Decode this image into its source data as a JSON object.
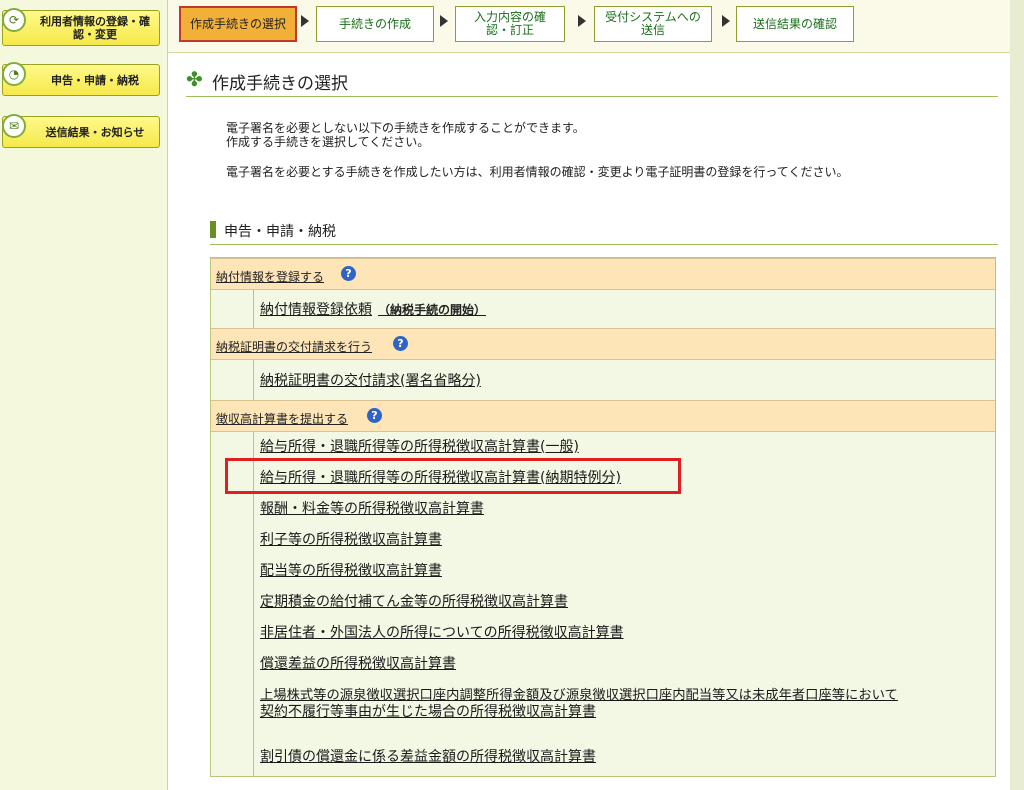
{
  "sidebar": {
    "items": [
      {
        "label": "利用者情報の登録・確認・変更",
        "icon": "refresh-icon"
      },
      {
        "label": "申告・申請・納税",
        "icon": "document-icon"
      },
      {
        "label": "送信結果・お知らせ",
        "icon": "mail-icon"
      }
    ]
  },
  "steps": [
    {
      "label": "作成手続きの選択",
      "active": true
    },
    {
      "label": "手続きの作成"
    },
    {
      "label": "入力内容の確認・訂正"
    },
    {
      "label": "受付システムへの送信"
    },
    {
      "label": "送信結果の確認"
    }
  ],
  "main": {
    "title": "作成手続きの選択",
    "para1_line1": "電子署名を必要としない以下の手続きを作成することができます。",
    "para1_line2": "作成する手続きを選択してください。",
    "para2": "電子署名を必要とする手続きを作成したい方は、利用者情報の確認・変更より電子証明書の登録を行ってください。",
    "section_title": "申告・申請・納税",
    "categories": [
      {
        "label": "納付情報を登録する",
        "items": [
          {
            "label": "納付情報登録依頼",
            "note": "（納税手続の開始）"
          }
        ]
      },
      {
        "label": "納税証明書の交付請求を行う",
        "items": [
          {
            "label": "納税証明書の交付請求(署名省略分)"
          }
        ]
      },
      {
        "label": "徴収高計算書を提出する",
        "items": [
          {
            "label": "給与所得・退職所得等の所得税徴収高計算書(一般)"
          },
          {
            "label": "給与所得・退職所得等の所得税徴収高計算書(納期特例分)",
            "highlighted": true
          },
          {
            "label": "報酬・料金等の所得税徴収高計算書"
          },
          {
            "label": "利子等の所得税徴収高計算書"
          },
          {
            "label": "配当等の所得税徴収高計算書"
          },
          {
            "label": "定期積金の給付補てん金等の所得税徴収高計算書"
          },
          {
            "label": "非居住者・外国法人の所得についての所得税徴収高計算書"
          },
          {
            "label": "償還差益の所得税徴収高計算書"
          },
          {
            "label": "上場株式等の源泉徴収選択口座内調整所得金額及び源泉徴収選択口座内配当等又は未成年者口座等において"
          },
          {
            "label": "契約不履行等事由が生じた場合の所得税徴収高計算書"
          },
          {
            "label": "割引債の償還金に係る差益金額の所得税徴収高計算書"
          }
        ]
      }
    ]
  },
  "colors": {
    "accent_active_step": "#f2b038",
    "highlight_box": "#e02020",
    "category_bg": "#fde5b8"
  }
}
